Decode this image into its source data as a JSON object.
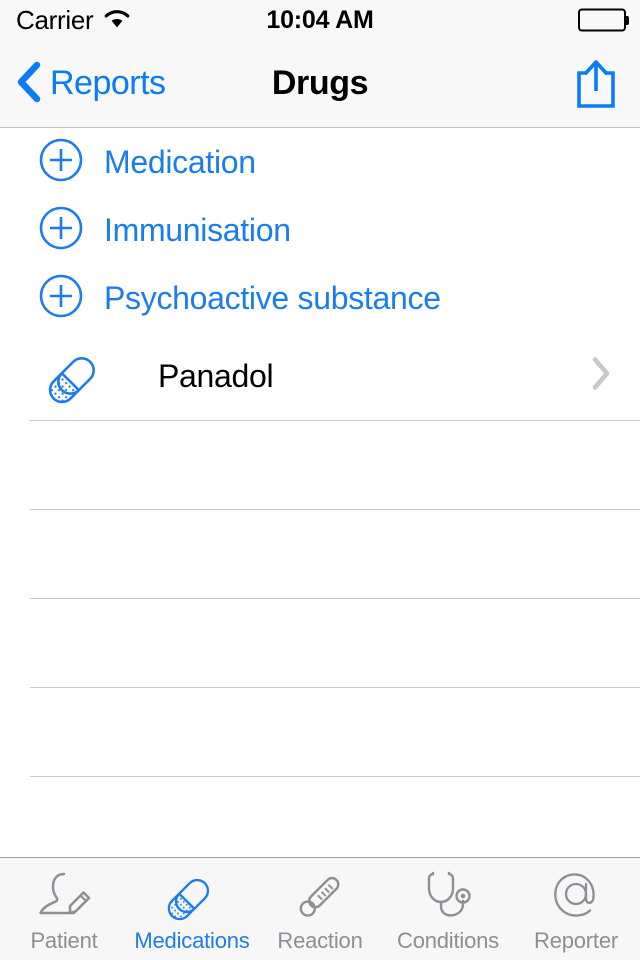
{
  "status_bar": {
    "carrier": "Carrier",
    "wifi_icon": "wifi-icon",
    "time": "10:04 AM",
    "battery_icon": "battery-full-icon"
  },
  "nav_bar": {
    "back_icon": "chevron-left-icon",
    "back_label": "Reports",
    "title": "Drugs",
    "share_icon": "share-icon"
  },
  "list": {
    "add_rows": [
      {
        "icon": "plus-circle-icon",
        "label": "Medication"
      },
      {
        "icon": "plus-circle-icon",
        "label": "Immunisation"
      },
      {
        "icon": "plus-circle-icon",
        "label": "Psychoactive substance"
      }
    ],
    "items": [
      {
        "icon": "capsule-icon",
        "label": "Panadol",
        "disclosure_icon": "chevron-right-icon"
      }
    ],
    "empty_row_count": 4
  },
  "tab_bar": {
    "tabs": [
      {
        "label": "Patient",
        "icon": "person-edit-icon",
        "active": false
      },
      {
        "label": "Medications",
        "icon": "capsule-icon",
        "active": true
      },
      {
        "label": "Reaction",
        "icon": "thermometer-icon",
        "active": false
      },
      {
        "label": "Conditions",
        "icon": "stethoscope-icon",
        "active": false
      },
      {
        "label": "Reporter",
        "icon": "at-sign-icon",
        "active": false
      }
    ]
  },
  "colors": {
    "accent_blue": "#1b7ced",
    "nav_blue": "#0a7cf5",
    "inactive_gray": "#8e8e93",
    "separator": "#c8c7cc",
    "bar_background": "#f7f7f7"
  }
}
